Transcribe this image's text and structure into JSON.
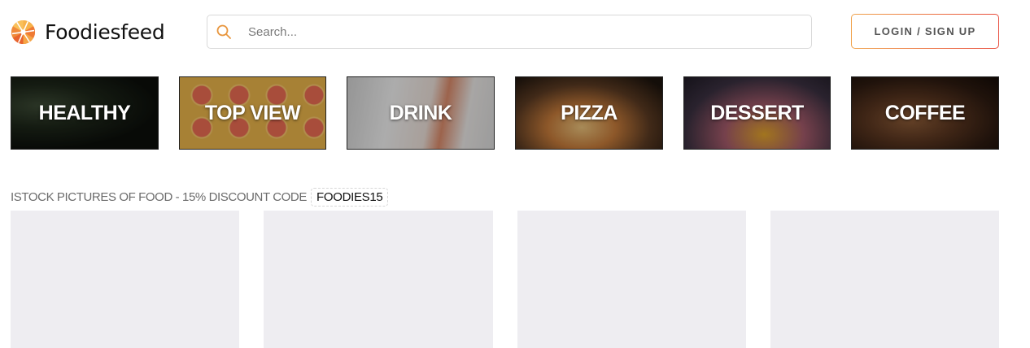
{
  "header": {
    "logo_text": "Foodiesfeed",
    "search_placeholder": "Search...",
    "login_label": "LOGIN / SIGN UP"
  },
  "categories": [
    {
      "label": "HEALTHY"
    },
    {
      "label": "TOP VIEW"
    },
    {
      "label": "DRINK"
    },
    {
      "label": "PIZZA"
    },
    {
      "label": "DESSERT"
    },
    {
      "label": "COFFEE"
    }
  ],
  "promo": {
    "text": "ISTOCK PICTURES OF FOOD - 15% DISCOUNT CODE",
    "code": "FOODIES15"
  },
  "colors": {
    "accent_orange": "#f0a24a",
    "accent_red": "#e84a3a",
    "placeholder_gray": "#eeedf1"
  },
  "icons": {
    "logo": "aperture-logo-icon",
    "search": "search-icon"
  }
}
